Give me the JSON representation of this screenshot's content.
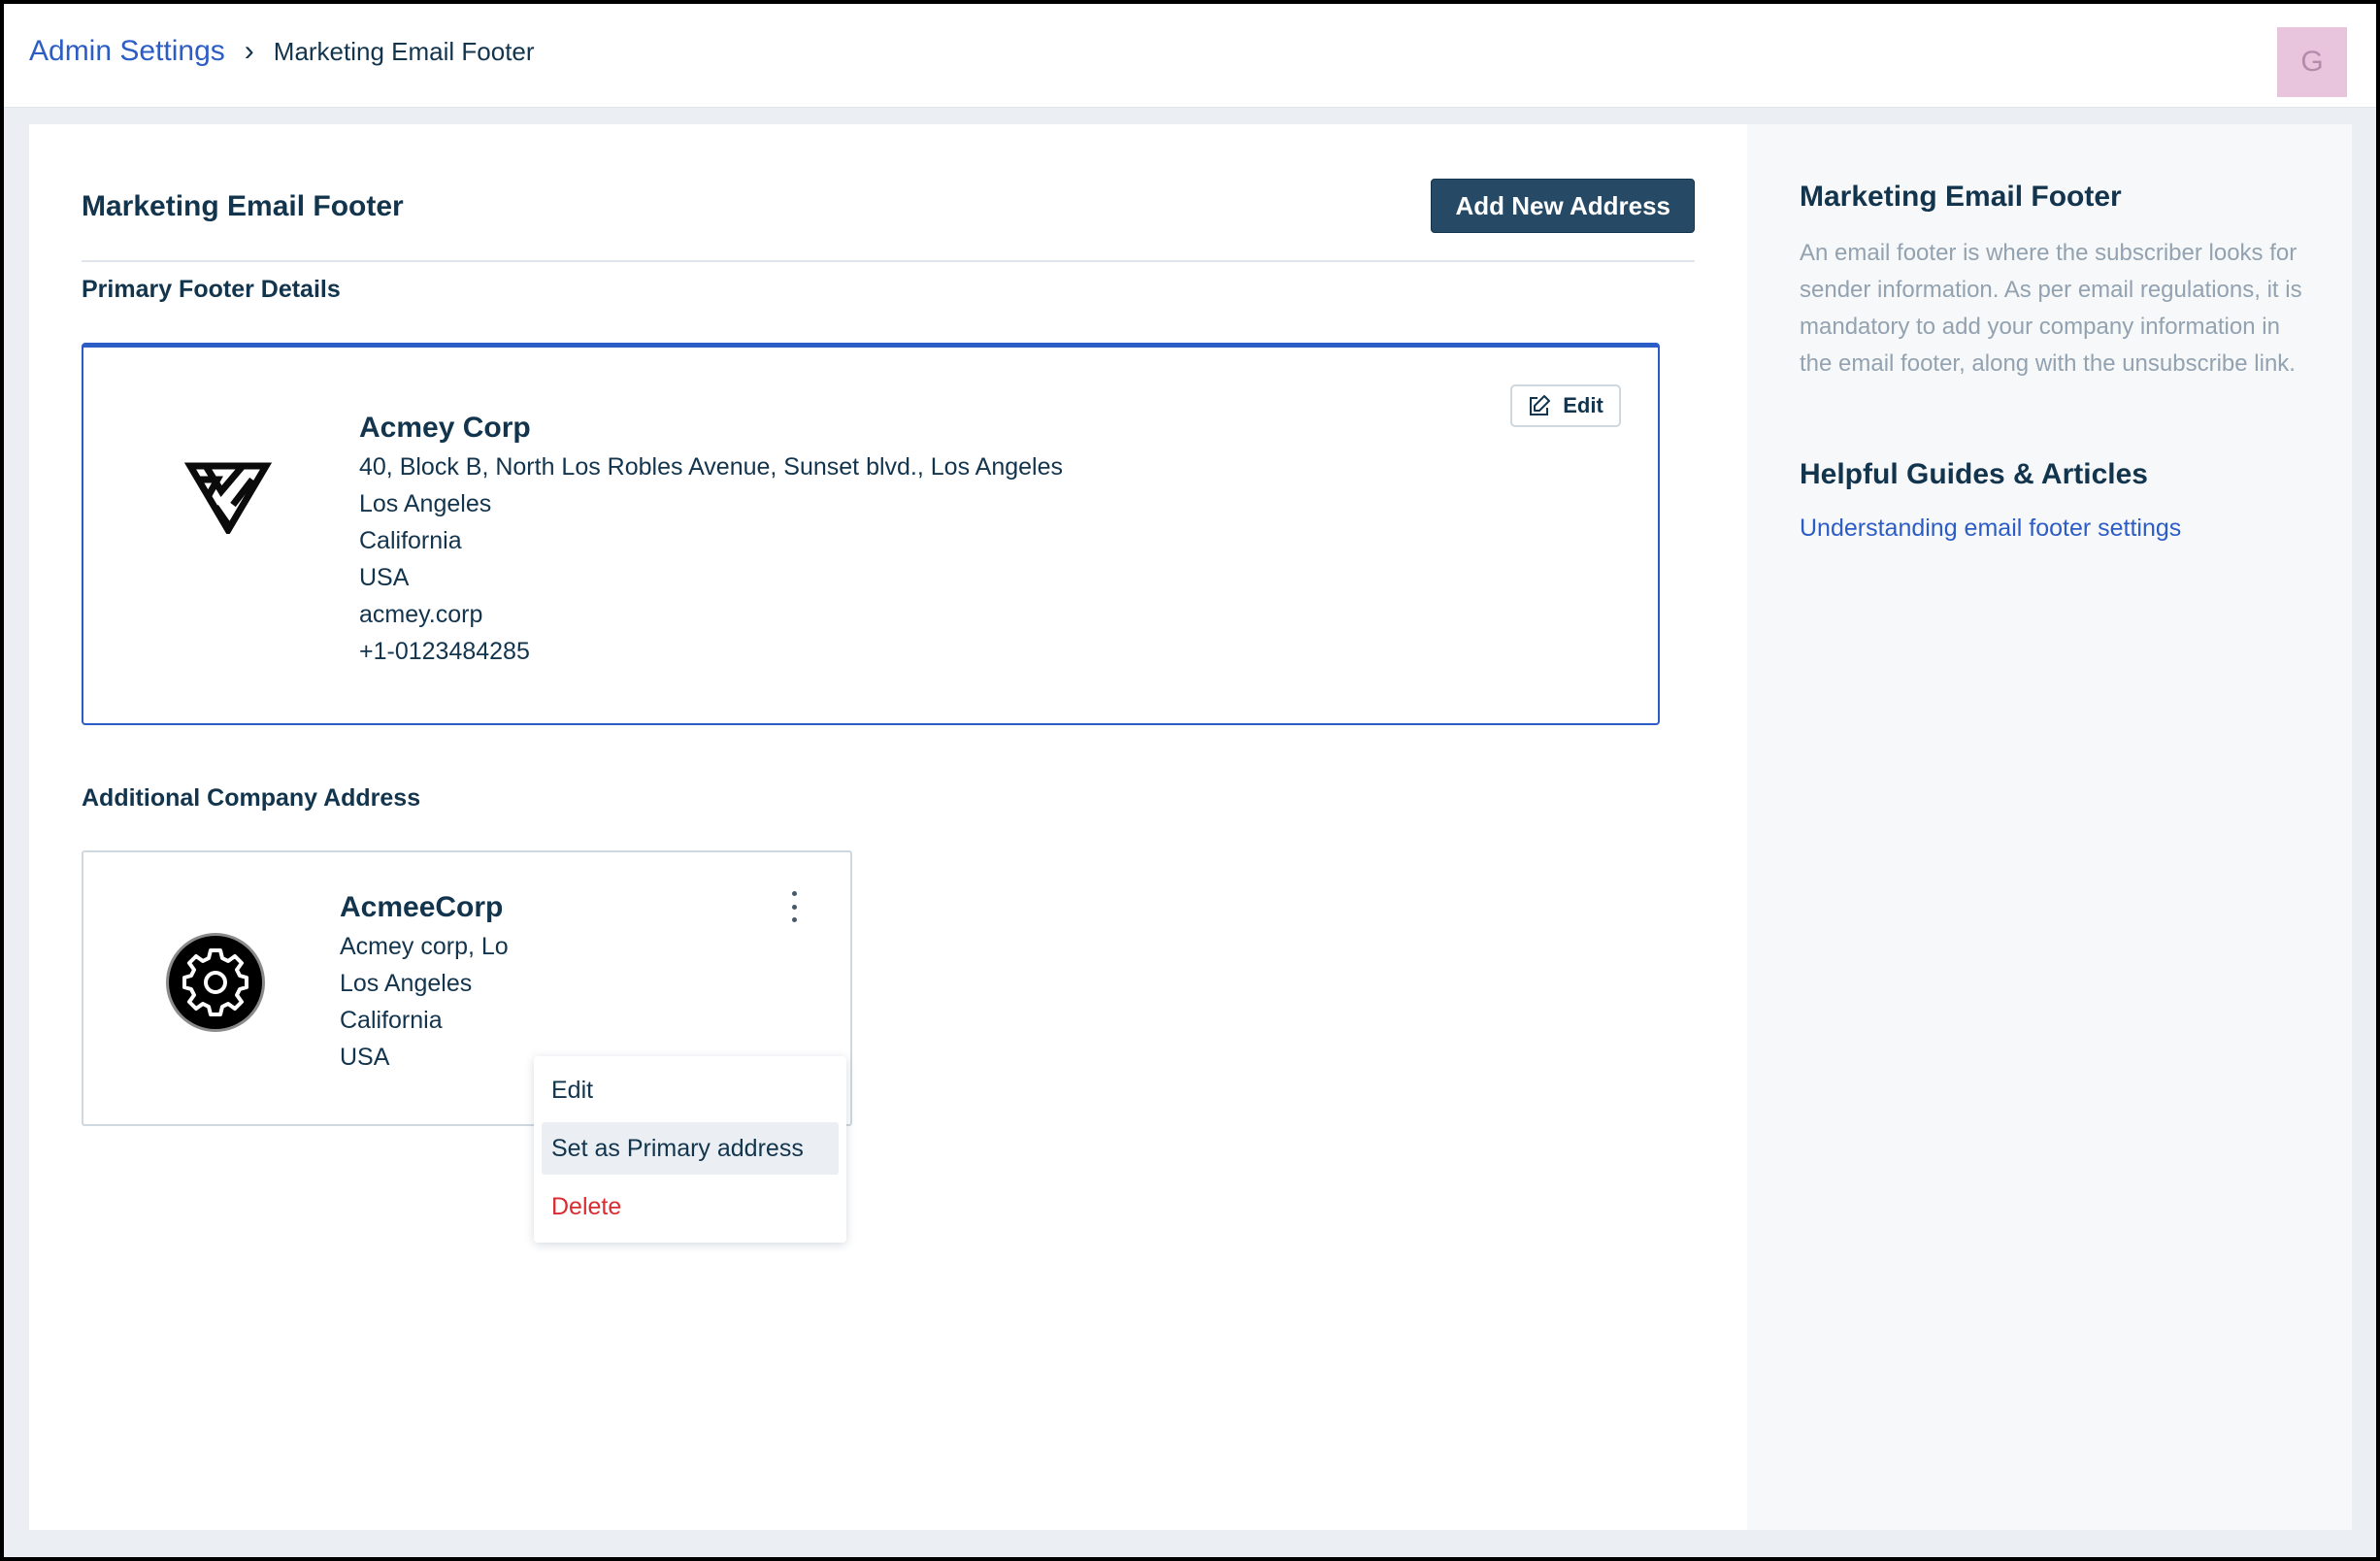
{
  "breadcrumb": {
    "parent": "Admin Settings",
    "separator": "›",
    "current": "Marketing Email Footer"
  },
  "avatar": {
    "initial": "G",
    "color": "#e8c4dd"
  },
  "header": {
    "title": "Marketing Email Footer",
    "add_button_label": "Add New Address"
  },
  "primary_section": {
    "title": "Primary Footer Details",
    "card": {
      "logo_icon": "triangular-geometric-logo",
      "name": "Acmey Corp",
      "lines": [
        "40, Block B, North Los Robles Avenue, Sunset blvd., Los Angeles",
        "Los Angeles",
        "California",
        "USA",
        "acmey.corp",
        "+1-0123484285"
      ],
      "edit_label": "Edit"
    }
  },
  "additional_section": {
    "title": "Additional Company Address",
    "card": {
      "logo_icon": "gear-logo",
      "name": "AcmeeCorp",
      "lines": [
        "Acmey corp, Lo",
        "Los Angeles",
        "California",
        "USA"
      ]
    },
    "menu": {
      "items": [
        "Edit",
        "Set as Primary address",
        "Delete"
      ]
    }
  },
  "aside": {
    "title": "Marketing Email Footer",
    "description": "An email footer is where the subscriber looks for sender information. As per email regulations, it is mandatory to add your company information in the email footer, along with the unsubscribe link.",
    "guides_title": "Helpful Guides & Articles",
    "guide_link": "Understanding email footer settings"
  },
  "colors": {
    "accent": "#2c5cc5",
    "primary_button": "#264966",
    "danger": "#d72d30",
    "text": "#12344d"
  }
}
